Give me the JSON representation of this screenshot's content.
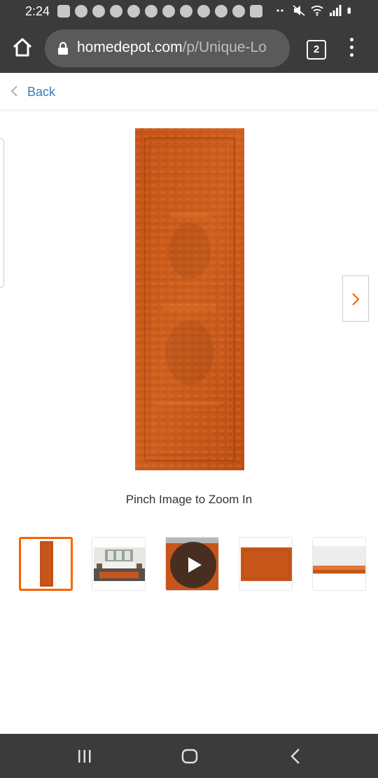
{
  "status_bar": {
    "time": "2:24"
  },
  "browser": {
    "url_domain": "homedepot.com",
    "url_path": "/p/Unique-Lo",
    "tab_count": "2"
  },
  "page": {
    "back_label": "Back",
    "zoom_hint": "Pinch Image to Zoom In"
  },
  "gallery": {
    "selected_index": 0,
    "thumbnails": [
      {
        "name": "runner-rug-full",
        "selected": true
      },
      {
        "name": "room-scene",
        "selected": false
      },
      {
        "name": "video",
        "selected": false,
        "has_play_icon": true
      },
      {
        "name": "rug-closeup",
        "selected": false
      },
      {
        "name": "rug-edge",
        "selected": false
      }
    ]
  },
  "colors": {
    "accent": "#f96302",
    "link": "#3e7bb6",
    "rug": "#c8561a",
    "chrome": "#3b3b3b"
  }
}
